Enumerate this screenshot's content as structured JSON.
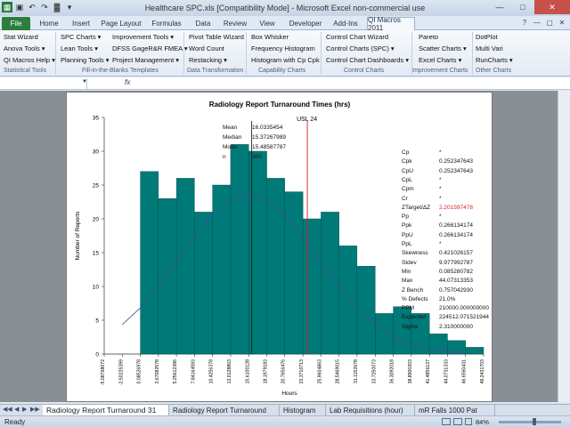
{
  "window": {
    "title": "Healthcare SPC.xls  [Compatibility Mode]  -  Microsoft Excel non-commercial use",
    "qat_icons": [
      "excel-logo-icon",
      "save-icon",
      "undo-icon",
      "redo-icon",
      "chart-icon",
      "customize-qat-icon"
    ]
  },
  "tabs": [
    "File",
    "Home",
    "Insert",
    "Page Layout",
    "Formulas",
    "Data",
    "Review",
    "View",
    "Developer",
    "Add-Ins",
    "QI Macros 2011"
  ],
  "active_tab": "QI Macros 2011",
  "ribbon": {
    "groups": [
      {
        "label": "Statistical Tools",
        "items": [
          "Stat Wizard",
          "Anova Tools ▾",
          "QI Macros Help ▾"
        ]
      },
      {
        "label": "Fill-in-the-Blanks Templates",
        "items": [
          "SPC Charts ▾",
          "Lean Tools ▾",
          "Planning Tools ▾",
          "Improvement Tools ▾",
          "DFSS GageR&R FMEA ▾",
          "Project Management ▾"
        ]
      },
      {
        "label": "Data Transformation",
        "items": [
          "Pivot Table Wizard",
          "Word Count",
          "Restacking ▾"
        ]
      },
      {
        "label": "Capability Charts",
        "items": [
          "Box Whisker",
          "Frequency Histogram",
          "Histogram with Cp Cpk"
        ]
      },
      {
        "label": "Control Charts",
        "items": [
          "Control Chart Wizard",
          "Control Charts (SPC) ▾",
          "Control Chart Dashboards ▾"
        ]
      },
      {
        "label": "Improvement Charts",
        "items": [
          "Pareto",
          "Scatter Charts ▾",
          "Excel Charts ▾"
        ]
      },
      {
        "label": "Other Charts",
        "items": [
          "DotPlot",
          "Multi Vari",
          "RunCharts ▾"
        ]
      }
    ]
  },
  "formula_bar": {
    "name_box": "",
    "fx_label": "fx",
    "formula": ""
  },
  "chart_data": {
    "type": "bar",
    "title": "Radiology Report Turnaround Times (hrs)",
    "xlabel": "Hours",
    "ylabel": "Number of Reports",
    "ylim": [
      0,
      35
    ],
    "yticks": [
      "0",
      "5",
      "10",
      "15",
      "20",
      "25",
      "30",
      "35"
    ],
    "xticks": [
      "-5.08768072",
      "-2.50225399",
      "0.08526978",
      "2.67082578",
      "5.25612286",
      "7.84164593",
      "10.4256378",
      "13.0128863",
      "15.6100128",
      "18.1979183",
      "20.7656476",
      "23.3710713",
      "25.9604863",
      "28.5469015",
      "31.1152678",
      "33.7250073",
      "36.3092018",
      "38.8900203",
      "41.4856127",
      "44.0731333",
      "46.6560431",
      "49.2431703"
    ],
    "values": [
      27,
      23,
      26,
      21,
      25,
      31,
      30,
      26,
      24,
      20,
      21,
      16,
      13,
      6,
      7,
      6,
      3,
      2,
      1,
      1
    ],
    "normal_curve": [
      [
        -2.502,
        4.37
      ],
      [
        0.085,
        6.83
      ],
      [
        2.671,
        9.97
      ],
      [
        5.256,
        13.58
      ],
      [
        7.842,
        17.27
      ],
      [
        10.426,
        20.51
      ],
      [
        13.013,
        22.73
      ],
      [
        15.61,
        23.51
      ],
      [
        18.198,
        22.73
      ],
      [
        20.766,
        20.51
      ],
      [
        23.371,
        17.27
      ],
      [
        25.96,
        13.58
      ],
      [
        28.547,
        9.97
      ],
      [
        31.115,
        6.83
      ],
      [
        33.725,
        4.37
      ],
      [
        36.309,
        2.61
      ],
      [
        38.89,
        1.45
      ],
      [
        41.486,
        0.75
      ],
      [
        44.073,
        0.37
      ],
      [
        46.656,
        0.17
      ]
    ],
    "mean_line": 16.0335454,
    "usl_line": 24,
    "usl_label": "USL  24",
    "mean_stats": [
      {
        "label": "Mean",
        "value": "16.0335454"
      },
      {
        "label": "Median",
        "value": "15.37267989"
      },
      {
        "label": "Mode",
        "value": "15.48587787"
      },
      {
        "label": "n",
        "value": "300"
      }
    ],
    "capability_stats": [
      {
        "label": "Cp",
        "value": "*"
      },
      {
        "label": "Cpk",
        "value": "0.252347643"
      },
      {
        "label": "CpU",
        "value": "0.252347643"
      },
      {
        "label": "CpL",
        "value": "*"
      },
      {
        "label": "Cpm",
        "value": "*"
      },
      {
        "label": "Cr",
        "value": "*"
      },
      {
        "label": "ZTarget/ΔZ",
        "value": "2.201597478",
        "highlight": true
      },
      {
        "label": "Pp",
        "value": "*"
      },
      {
        "label": "Ppk",
        "value": "0.266134174"
      },
      {
        "label": "PpU",
        "value": "0.266134174"
      },
      {
        "label": "PpL",
        "value": "*"
      },
      {
        "label": "Skewness",
        "value": "0.421026157"
      },
      {
        "label": "Stdev",
        "value": "9.977992787"
      },
      {
        "label": "Min",
        "value": "0.085280782"
      },
      {
        "label": "Max",
        "value": "44.07313353"
      },
      {
        "label": "Z Bench",
        "value": "0.757042930"
      },
      {
        "label": "% Defects",
        "value": "21.0%"
      },
      {
        "label": "PPM",
        "value": "210000.000000000"
      },
      {
        "label": "Expected",
        "value": "224512.071521944"
      },
      {
        "label": "Sigma",
        "value": "2.310000000"
      }
    ],
    "colors": {
      "bar": "#007a78",
      "curve": "#4a4a9a",
      "usl": "#d81e1e",
      "mean": "#222222",
      "highlight": "#d81e1e"
    }
  },
  "sheet_tabs": [
    "Radiology Report Turnaround  31",
    "Radiology Report Turnaround",
    "Histogram",
    "Lab Requisitions (hour)",
    "mR Falls 1000 Pat"
  ],
  "active_sheet": 0,
  "status": {
    "text": "Ready",
    "zoom": "84%"
  }
}
